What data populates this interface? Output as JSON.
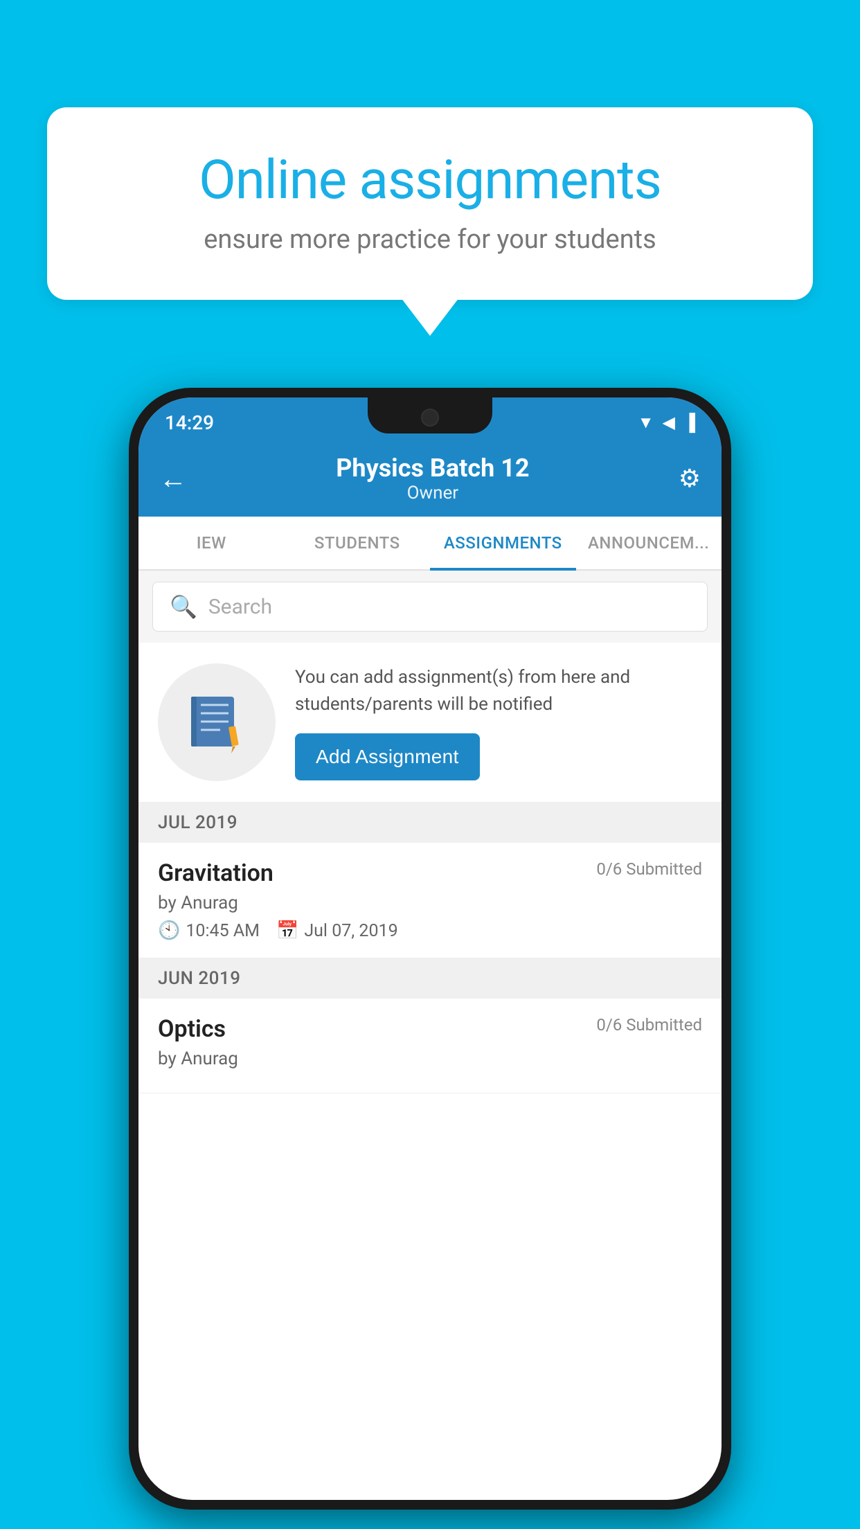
{
  "background_color": "#00BFEA",
  "bubble": {
    "title": "Online assignments",
    "subtitle": "ensure more practice for your students"
  },
  "phone": {
    "status_bar": {
      "time": "14:29",
      "icons": [
        "wifi",
        "signal",
        "battery"
      ]
    },
    "header": {
      "title": "Physics Batch 12",
      "subtitle": "Owner",
      "back_label": "←",
      "settings_label": "⚙"
    },
    "tabs": [
      {
        "label": "IEW",
        "active": false
      },
      {
        "label": "STUDENTS",
        "active": false
      },
      {
        "label": "ASSIGNMENTS",
        "active": true
      },
      {
        "label": "ANNOUNCEM...",
        "active": false
      }
    ],
    "search": {
      "placeholder": "Search"
    },
    "promo": {
      "text": "You can add assignment(s) from here and students/parents will be notified",
      "button_label": "Add Assignment"
    },
    "assignment_groups": [
      {
        "month": "JUL 2019",
        "assignments": [
          {
            "name": "Gravitation",
            "submitted": "0/6 Submitted",
            "by": "by Anurag",
            "time": "10:45 AM",
            "date": "Jul 07, 2019"
          }
        ]
      },
      {
        "month": "JUN 2019",
        "assignments": [
          {
            "name": "Optics",
            "submitted": "0/6 Submitted",
            "by": "by Anurag",
            "time": "",
            "date": ""
          }
        ]
      }
    ]
  }
}
